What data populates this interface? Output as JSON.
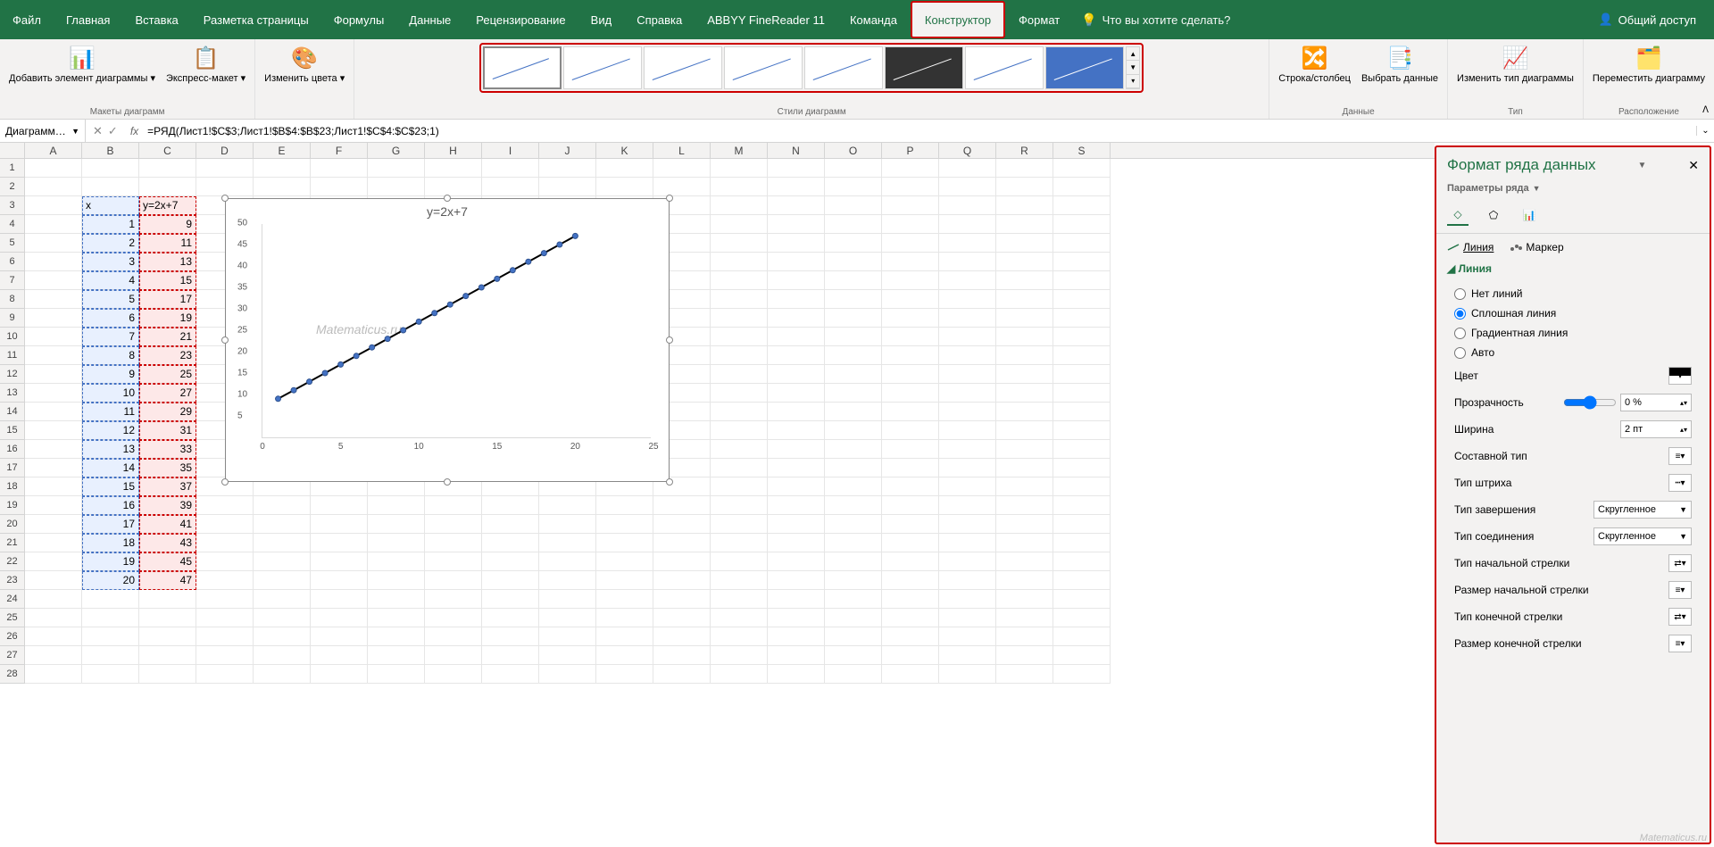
{
  "titlebar": {
    "tabs": [
      "Файл",
      "Главная",
      "Вставка",
      "Разметка страницы",
      "Формулы",
      "Данные",
      "Рецензирование",
      "Вид",
      "Справка",
      "ABBYY FineReader 11",
      "Команда",
      "Конструктор",
      "Формат"
    ],
    "active_tab": "Конструктор",
    "tellme": "Что вы хотите сделать?",
    "share": "Общий доступ"
  },
  "ribbon": {
    "groups": {
      "layouts": {
        "add_element": "Добавить элемент диаграммы ▾",
        "quick_layout": "Экспресс-макет ▾",
        "label": "Макеты диаграмм"
      },
      "colors": {
        "change_colors": "Изменить цвета ▾"
      },
      "styles": {
        "label": "Стили диаграмм"
      },
      "data": {
        "switch": "Строка/столбец",
        "select": "Выбрать данные",
        "label": "Данные"
      },
      "type": {
        "change": "Изменить тип диаграммы",
        "label": "Тип"
      },
      "location": {
        "move": "Переместить диаграмму",
        "label": "Расположение"
      }
    }
  },
  "formulabar": {
    "namebox": "Диаграмм…",
    "formula": "=РЯД(Лист1!$C$3;Лист1!$B$4:$B$23;Лист1!$C$4:$C$23;1)"
  },
  "columns": [
    "A",
    "B",
    "C",
    "D",
    "E",
    "F",
    "G",
    "H",
    "I",
    "J",
    "K",
    "L",
    "M",
    "N",
    "O",
    "P",
    "Q",
    "R",
    "S"
  ],
  "table": {
    "header_b": "x",
    "header_c": "y=2x+7",
    "rows": [
      {
        "r": 4,
        "b": "1",
        "c": "9"
      },
      {
        "r": 5,
        "b": "2",
        "c": "11"
      },
      {
        "r": 6,
        "b": "3",
        "c": "13"
      },
      {
        "r": 7,
        "b": "4",
        "c": "15"
      },
      {
        "r": 8,
        "b": "5",
        "c": "17"
      },
      {
        "r": 9,
        "b": "6",
        "c": "19"
      },
      {
        "r": 10,
        "b": "7",
        "c": "21"
      },
      {
        "r": 11,
        "b": "8",
        "c": "23"
      },
      {
        "r": 12,
        "b": "9",
        "c": "25"
      },
      {
        "r": 13,
        "b": "10",
        "c": "27"
      },
      {
        "r": 14,
        "b": "11",
        "c": "29"
      },
      {
        "r": 15,
        "b": "12",
        "c": "31"
      },
      {
        "r": 16,
        "b": "13",
        "c": "33"
      },
      {
        "r": 17,
        "b": "14",
        "c": "35"
      },
      {
        "r": 18,
        "b": "15",
        "c": "37"
      },
      {
        "r": 19,
        "b": "16",
        "c": "39"
      },
      {
        "r": 20,
        "b": "17",
        "c": "41"
      },
      {
        "r": 21,
        "b": "18",
        "c": "43"
      },
      {
        "r": 22,
        "b": "19",
        "c": "45"
      },
      {
        "r": 23,
        "b": "20",
        "c": "47"
      }
    ]
  },
  "chart_data": {
    "type": "line",
    "title": "y=2x+7",
    "x": [
      1,
      2,
      3,
      4,
      5,
      6,
      7,
      8,
      9,
      10,
      11,
      12,
      13,
      14,
      15,
      16,
      17,
      18,
      19,
      20
    ],
    "y": [
      9,
      11,
      13,
      15,
      17,
      19,
      21,
      23,
      25,
      27,
      29,
      31,
      33,
      35,
      37,
      39,
      41,
      43,
      45,
      47
    ],
    "xticks": [
      0,
      5,
      10,
      15,
      20,
      25
    ],
    "yticks": [
      5,
      10,
      15,
      20,
      25,
      30,
      35,
      40,
      45,
      50
    ],
    "xlim": [
      0,
      25
    ],
    "ylim": [
      0,
      50
    ],
    "watermark": "Matematicus.ru"
  },
  "sidepanel": {
    "title": "Формат ряда данных",
    "subtitle": "Параметры ряда",
    "tab_line": "Линия",
    "tab_marker": "Маркер",
    "section": "Линия",
    "radios": {
      "none": "Нет линий",
      "solid": "Сплошная линия",
      "gradient": "Градиентная линия",
      "auto": "Авто"
    },
    "radio_selected": "solid",
    "rows": {
      "color": "Цвет",
      "transparency": "Прозрачность",
      "transparency_val": "0 %",
      "width": "Ширина",
      "width_val": "2 пт",
      "compound": "Составной тип",
      "dash": "Тип штриха",
      "cap": "Тип завершения",
      "cap_val": "Скругленное",
      "join": "Тип соединения",
      "join_val": "Скругленное",
      "arrow_start_type": "Тип начальной стрелки",
      "arrow_start_size": "Размер начальной стрелки",
      "arrow_end_type": "Тип конечной стрелки",
      "arrow_end_size": "Размер конечной стрелки"
    }
  },
  "watermark2": "Matematicus.ru"
}
